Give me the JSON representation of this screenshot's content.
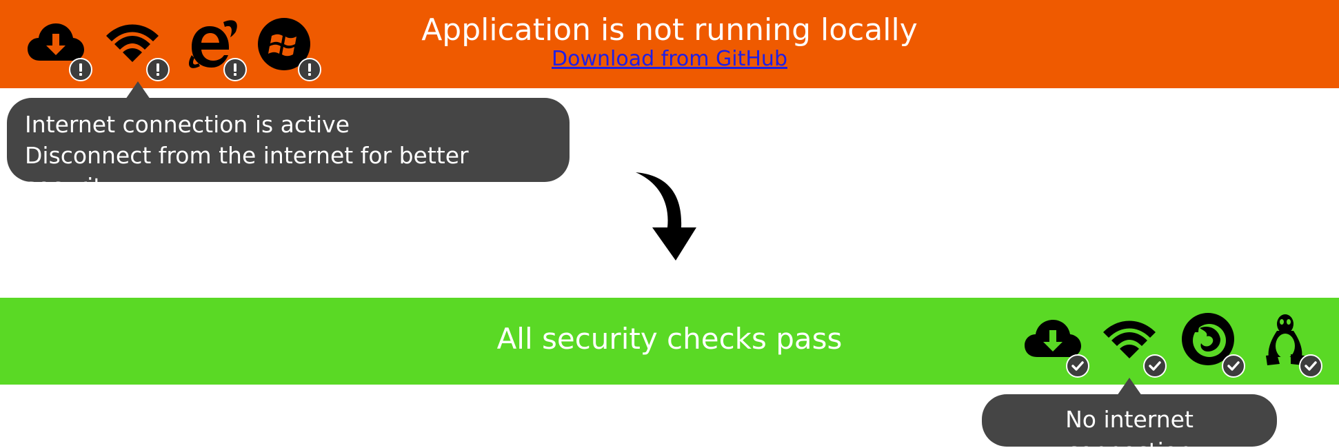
{
  "colors": {
    "warning_banner": "#ef5a00",
    "success_banner": "#5ad925",
    "tooltip_bg": "#454545",
    "icon": "#000000",
    "badge_bg": "#3d3d3d",
    "badge_glyph": "#ffffff",
    "link": "#1f1fe6"
  },
  "warning_banner": {
    "title": "Application is not running locally",
    "link_text": "Download from GitHub",
    "icons": [
      {
        "name": "cloud-download-icon",
        "status": "warning"
      },
      {
        "name": "wifi-icon",
        "status": "warning"
      },
      {
        "name": "internet-explorer-icon",
        "status": "warning"
      },
      {
        "name": "windows-icon",
        "status": "warning"
      }
    ]
  },
  "warning_tooltip": {
    "line1": "Internet connection is active",
    "line2": "Disconnect from the internet for better security"
  },
  "transition_icon": "curved-down-arrow-icon",
  "success_banner": {
    "title": "All security checks pass",
    "icons": [
      {
        "name": "cloud-download-icon",
        "status": "ok"
      },
      {
        "name": "wifi-icon",
        "status": "ok"
      },
      {
        "name": "firefox-icon",
        "status": "ok"
      },
      {
        "name": "linux-tux-icon",
        "status": "ok"
      }
    ]
  },
  "success_tooltip": {
    "text": "No internet connection"
  }
}
